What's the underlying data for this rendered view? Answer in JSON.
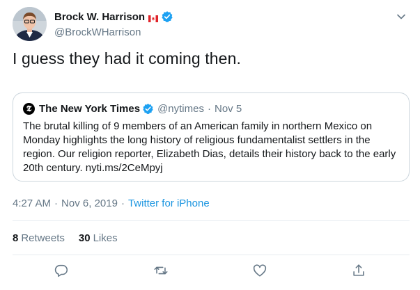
{
  "author": {
    "name": "Brock W. Harrison",
    "handle": "@BrockWHarrison",
    "flag_icon": "canada-flag-icon",
    "verified_icon": "verified-badge-icon"
  },
  "tweet": {
    "text": "I guess they had it coming then."
  },
  "quoted": {
    "name": "The New York Times",
    "handle": "@nytimes",
    "date": "Nov 5",
    "text": "The brutal killing of 9 members of an American family in northern Mexico on Monday highlights the long history of religious fundamentalist settlers in the region. Our religion reporter, Elizabeth Dias, details their history back to the early 20th century. nyti.ms/2CeMpyj",
    "logo_glyph": "𝕿"
  },
  "meta": {
    "time": "4:27 AM",
    "date": "Nov 6, 2019",
    "source": "Twitter for iPhone",
    "separator": "·"
  },
  "stats": {
    "retweets_count": "8",
    "retweets_label": "Retweets",
    "likes_count": "30",
    "likes_label": "Likes"
  },
  "colors": {
    "accent": "#1da1f2",
    "link": "#1b95e0",
    "secondary_text": "#657786",
    "border": "#ccd6dd"
  },
  "actions": [
    "reply-icon",
    "retweet-icon",
    "like-icon",
    "share-icon"
  ]
}
